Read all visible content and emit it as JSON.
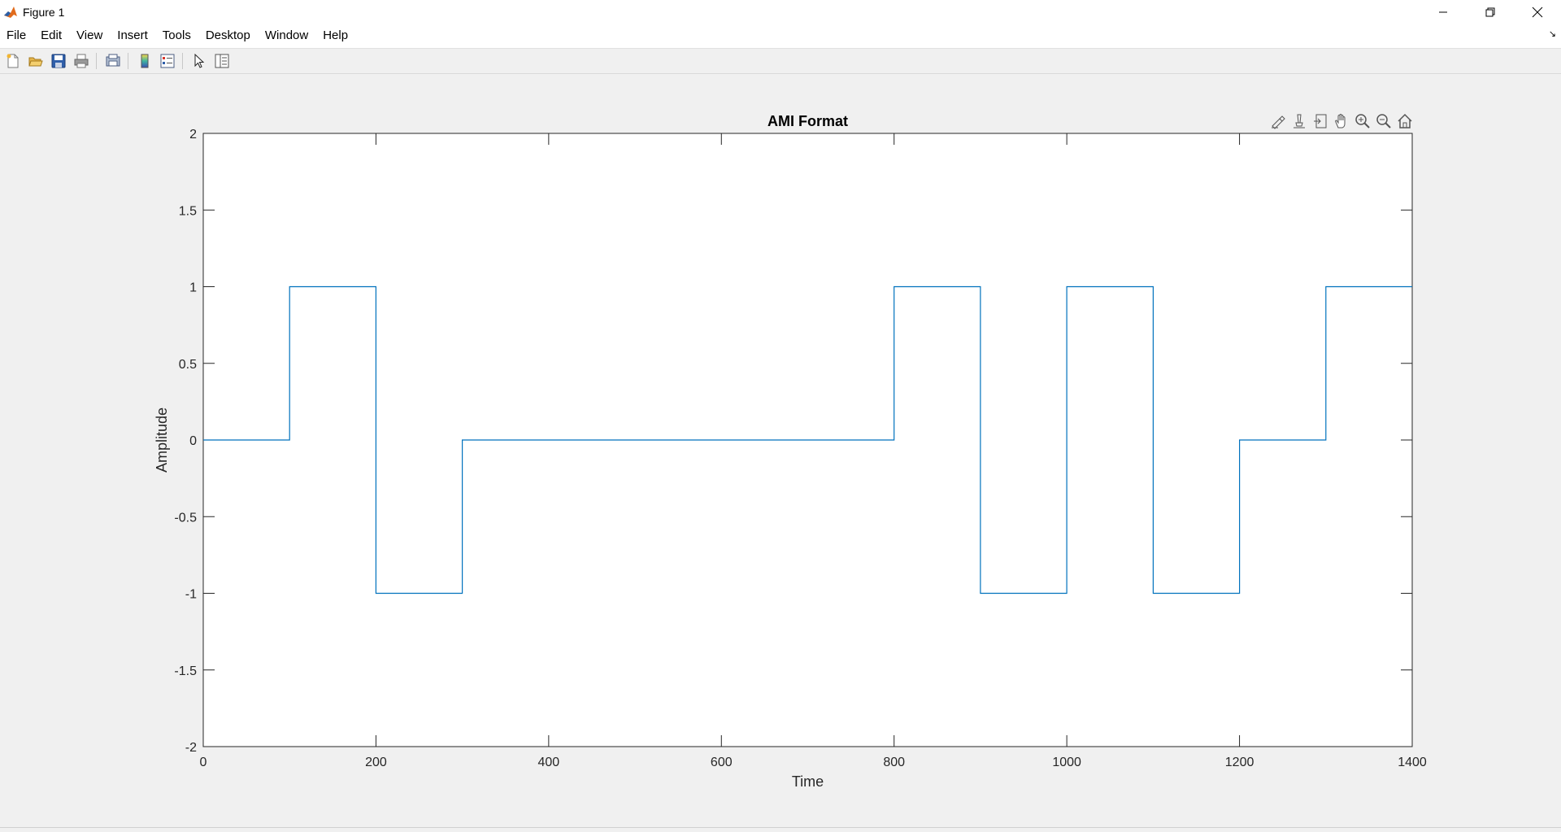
{
  "window": {
    "title": "Figure 1",
    "icon": "matlab-icon",
    "controls": [
      "minimize-icon",
      "restore-icon",
      "close-icon"
    ]
  },
  "menubar": {
    "items": [
      "File",
      "Edit",
      "View",
      "Insert",
      "Tools",
      "Desktop",
      "Window",
      "Help"
    ]
  },
  "toolbar": {
    "buttons": [
      "new-figure-icon",
      "open-file-icon",
      "save-icon",
      "print-icon",
      "print-preview-icon",
      "colorbar-icon",
      "legend-icon",
      "edit-plot-icon",
      "property-inspector-icon"
    ]
  },
  "axes_toolbar": {
    "buttons": [
      "brush-icon",
      "data-tips-icon",
      "export-icon",
      "pan-icon",
      "zoom-in-icon",
      "zoom-out-icon",
      "home-icon"
    ]
  },
  "chart_data": {
    "type": "line",
    "title": "AMI Format",
    "xlabel": "Time",
    "ylabel": "Amplitude",
    "xlim": [
      0,
      1400
    ],
    "ylim": [
      -2,
      2
    ],
    "xticks": [
      0,
      200,
      400,
      600,
      800,
      1000,
      1200,
      1400
    ],
    "yticks": [
      -2,
      -1.5,
      -1,
      -0.5,
      0,
      0.5,
      1,
      1.5,
      2
    ],
    "xtick_labels": [
      "0",
      "200",
      "400",
      "600",
      "800",
      "1000",
      "1200",
      "1400"
    ],
    "ytick_labels": [
      "-2",
      "-1.5",
      "-1",
      "-0.5",
      "0",
      "0.5",
      "1",
      "1.5",
      "2"
    ],
    "grid": false,
    "line_color": "#0072BD",
    "series": [
      {
        "x": [
          0,
          100,
          100,
          200,
          200,
          300,
          300,
          800,
          800,
          900,
          900,
          1000,
          1000,
          1100,
          1100,
          1200,
          1200,
          1300,
          1300,
          1400
        ],
        "y": [
          0,
          0,
          1,
          1,
          -1,
          -1,
          0,
          0,
          1,
          1,
          -1,
          -1,
          1,
          1,
          -1,
          -1,
          0,
          0,
          1,
          1
        ]
      }
    ]
  }
}
